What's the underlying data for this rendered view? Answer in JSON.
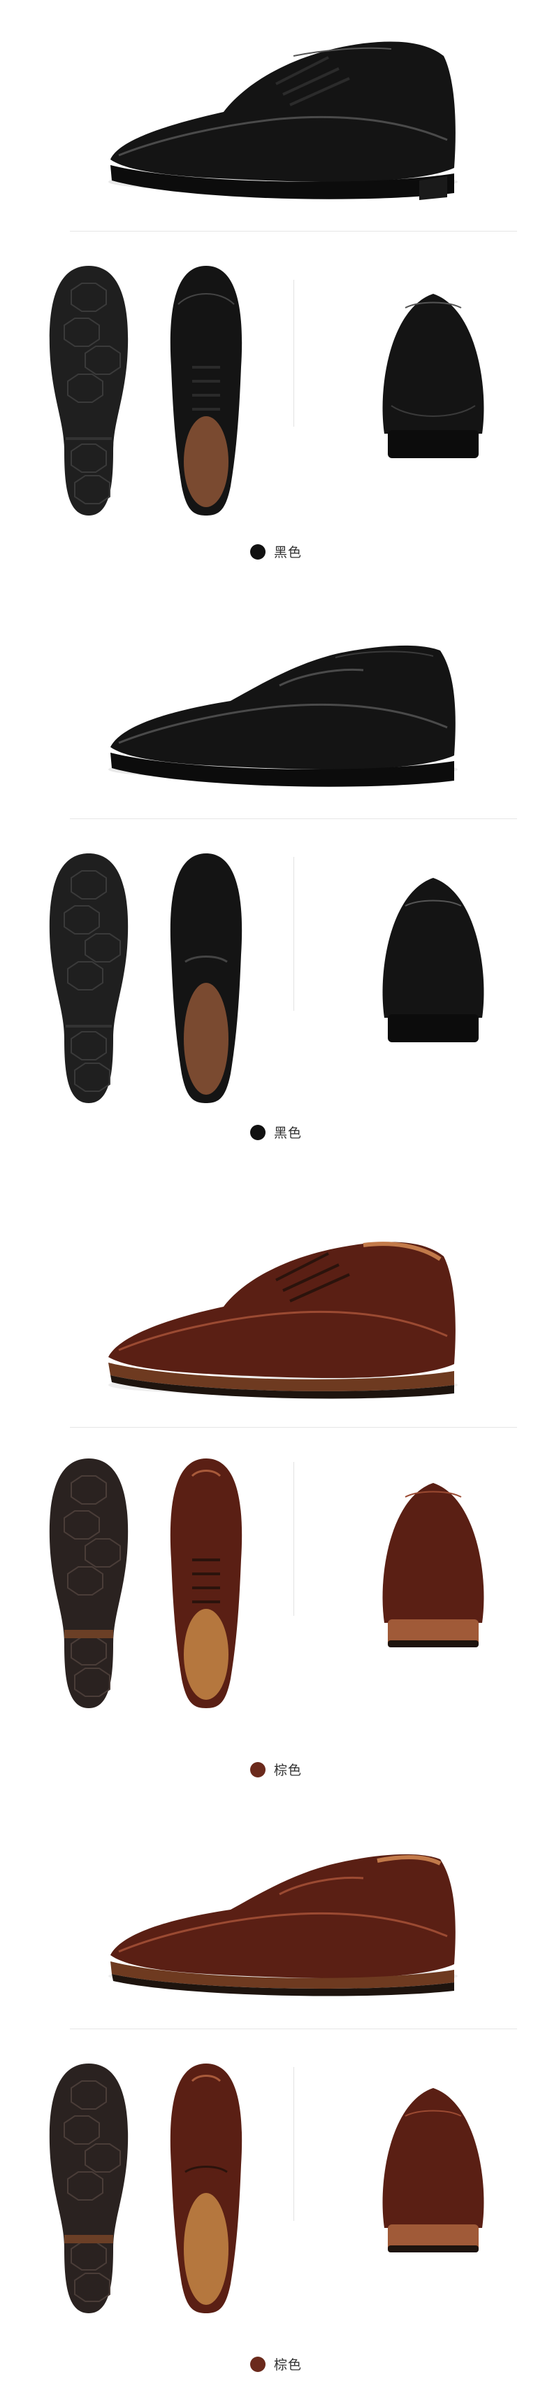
{
  "colors": {
    "black_leather": "#151515",
    "black_highlight": "#4a4a4a",
    "brown_leather": "#5a1f14",
    "brown_highlight": "#9b4a32",
    "brown_sole": "#5b3b29",
    "sole_rubber": "#1d1d1d",
    "lining_tan": "#8a5a3a"
  },
  "variants": [
    {
      "name": "black-lace-up",
      "swatch_color": "#111111",
      "swatch_label": "黑色"
    },
    {
      "name": "black-slip-on",
      "swatch_color": "#111111",
      "swatch_label": "黑色"
    },
    {
      "name": "brown-lace-up",
      "swatch_color": "#6b2a1c",
      "swatch_label": "棕色"
    },
    {
      "name": "brown-slip-on",
      "swatch_color": "#6b2a1c",
      "swatch_label": "棕色"
    }
  ]
}
